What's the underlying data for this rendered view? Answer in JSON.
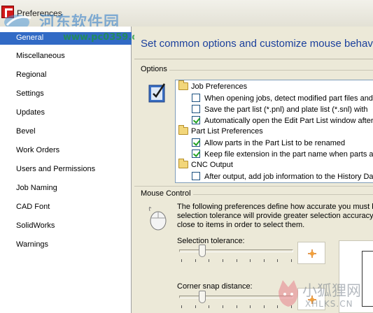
{
  "window": {
    "title": "Preferences"
  },
  "watermark_top": {
    "site": "河东软件园",
    "url": "www.pc0359.cn"
  },
  "watermark_bottom": {
    "name": "小狐狸网",
    "url": "XHLKS.CN"
  },
  "sidebar": {
    "selected_label": "General",
    "items": [
      {
        "label": "Miscellaneous"
      },
      {
        "label": "Regional"
      },
      {
        "label": "Settings"
      },
      {
        "label": "Updates"
      },
      {
        "label": "Bevel"
      },
      {
        "label": "Work Orders"
      },
      {
        "label": "Users and Permissions"
      },
      {
        "label": "Job Naming"
      },
      {
        "label": "CAD Font"
      },
      {
        "label": "SolidWorks"
      },
      {
        "label": "Warnings"
      }
    ]
  },
  "main": {
    "heading": "Set common options and customize mouse behavio",
    "options_group": "Options",
    "tree": {
      "job_preferences": {
        "label": "Job Preferences",
        "items": [
          {
            "label": "When opening jobs, detect modified part files and",
            "checked": false
          },
          {
            "label": "Save the part list (*.pnl) and plate list (*.snl) with",
            "checked": false
          },
          {
            "label": "Automatically open the Edit Part List window after",
            "checked": true
          }
        ]
      },
      "part_list_preferences": {
        "label": "Part List Preferences",
        "items": [
          {
            "label": "Allow parts in the Part List to be renamed",
            "checked": true
          },
          {
            "label": "Keep file extension in the part name when parts ar",
            "checked": true
          }
        ]
      },
      "cnc_output": {
        "label": "CNC Output",
        "items": [
          {
            "label": "After output, add job information to the History Da",
            "checked": false
          }
        ]
      }
    },
    "mouse_group": "Mouse Control",
    "mouse_description": [
      "The following preferences define how accurate you must b",
      "selection tolerance will provide greater selection accuracy",
      "close to items in order to select them."
    ],
    "selection_tolerance": {
      "label": "Selection tolerance:",
      "value": 0.2
    },
    "corner_snap": {
      "label": "Corner snap distance:",
      "value": 0.2
    }
  },
  "colors": {
    "selection": "#316ac5",
    "heading": "#1a3f9c",
    "check": "#21a121"
  }
}
